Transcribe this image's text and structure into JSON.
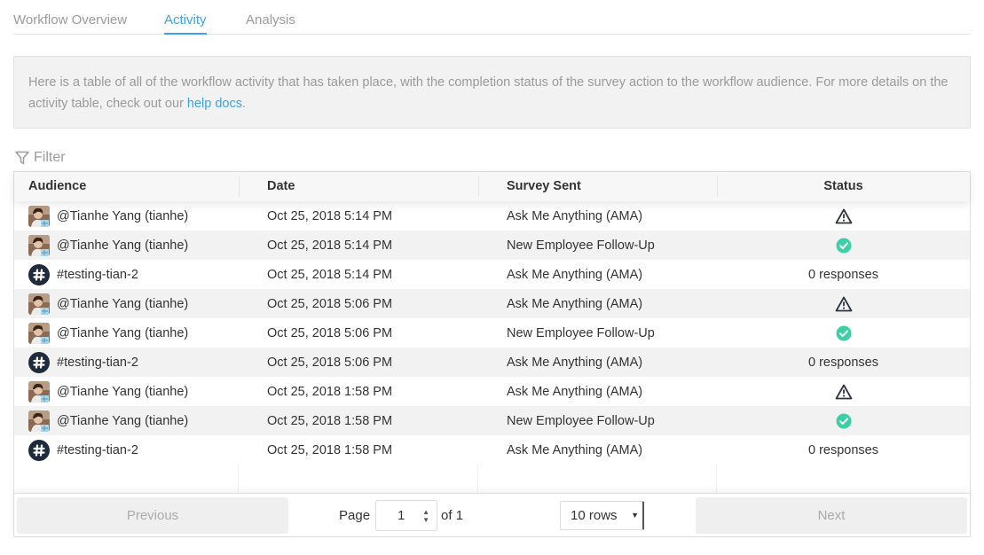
{
  "tabs": [
    {
      "label": "Workflow Overview"
    },
    {
      "label": "Activity"
    },
    {
      "label": "Analysis"
    }
  ],
  "info": {
    "text": "Here is a table of all of the workflow activity that has taken place, with the completion status of the survey action to the workflow audience. For more details on the activity table, check out our ",
    "link": "help docs",
    "suffix": "."
  },
  "filter": {
    "label": "Filter"
  },
  "table": {
    "headers": [
      "Audience",
      "Date",
      "Survey Sent",
      "Status"
    ],
    "rows": [
      {
        "type": "user",
        "audience": "@Tianhe Yang (tianhe)",
        "date": "Oct 25, 2018 5:14 PM",
        "survey": "Ask Me Anything (AMA)",
        "status": "warning",
        "status_text": ""
      },
      {
        "type": "user",
        "audience": "@Tianhe Yang (tianhe)",
        "date": "Oct 25, 2018 5:14 PM",
        "survey": "New Employee Follow-Up",
        "status": "complete",
        "status_text": ""
      },
      {
        "type": "channel",
        "audience": "#testing-tian-2",
        "date": "Oct 25, 2018 5:14 PM",
        "survey": "Ask Me Anything (AMA)",
        "status": "text",
        "status_text": "0 responses"
      },
      {
        "type": "user",
        "audience": "@Tianhe Yang (tianhe)",
        "date": "Oct 25, 2018 5:06 PM",
        "survey": "Ask Me Anything (AMA)",
        "status": "warning",
        "status_text": ""
      },
      {
        "type": "user",
        "audience": "@Tianhe Yang (tianhe)",
        "date": "Oct 25, 2018 5:06 PM",
        "survey": "New Employee Follow-Up",
        "status": "complete",
        "status_text": ""
      },
      {
        "type": "channel",
        "audience": "#testing-tian-2",
        "date": "Oct 25, 2018 5:06 PM",
        "survey": "Ask Me Anything (AMA)",
        "status": "text",
        "status_text": "0 responses"
      },
      {
        "type": "user",
        "audience": "@Tianhe Yang (tianhe)",
        "date": "Oct 25, 2018 1:58 PM",
        "survey": "Ask Me Anything (AMA)",
        "status": "warning",
        "status_text": ""
      },
      {
        "type": "user",
        "audience": "@Tianhe Yang (tianhe)",
        "date": "Oct 25, 2018 1:58 PM",
        "survey": "New Employee Follow-Up",
        "status": "complete",
        "status_text": ""
      },
      {
        "type": "channel",
        "audience": "#testing-tian-2",
        "date": "Oct 25, 2018 1:58 PM",
        "survey": "Ask Me Anything (AMA)",
        "status": "text",
        "status_text": "0 responses"
      }
    ]
  },
  "pagination": {
    "previous": "Previous",
    "page_label": "Page",
    "page_value": "1",
    "of_label": "of 1",
    "rows_select": "10 rows",
    "next": "Next"
  },
  "colors": {
    "accent": "#3aa3e3",
    "success": "#3dcfa6",
    "channel_badge": "#1e2b3c"
  },
  "icons": {
    "filter": "filter-funnel-icon",
    "warning": "warning-triangle-icon",
    "complete": "check-circle-icon",
    "channel": "hash-icon"
  }
}
